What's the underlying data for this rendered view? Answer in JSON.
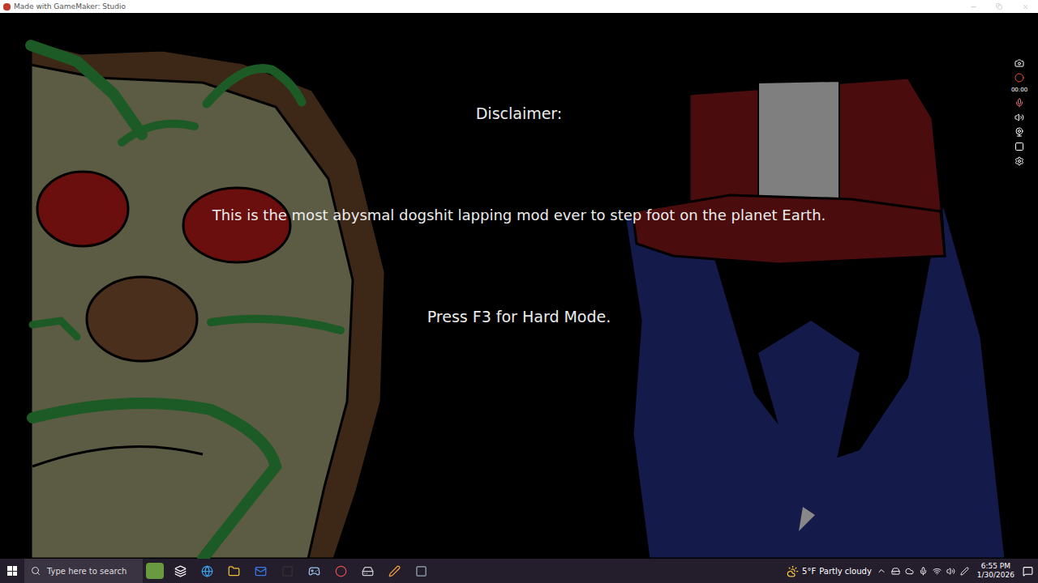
{
  "window": {
    "title": "Made with GameMaker: Studio"
  },
  "game": {
    "heading": "Disclaimer:",
    "message": "This is the most abysmal dogshit lapping mod ever to step foot on the planet Earth.",
    "hint": "Press F3 for Hard Mode."
  },
  "recorder": {
    "timer": "00:00"
  },
  "taskbar": {
    "search": {
      "placeholder": "Type here to search"
    },
    "weather": {
      "temperature": "5°F",
      "condition": "Partly cloudy"
    },
    "clock": {
      "time": "6:55 PM",
      "date": "1/30/2026"
    }
  }
}
